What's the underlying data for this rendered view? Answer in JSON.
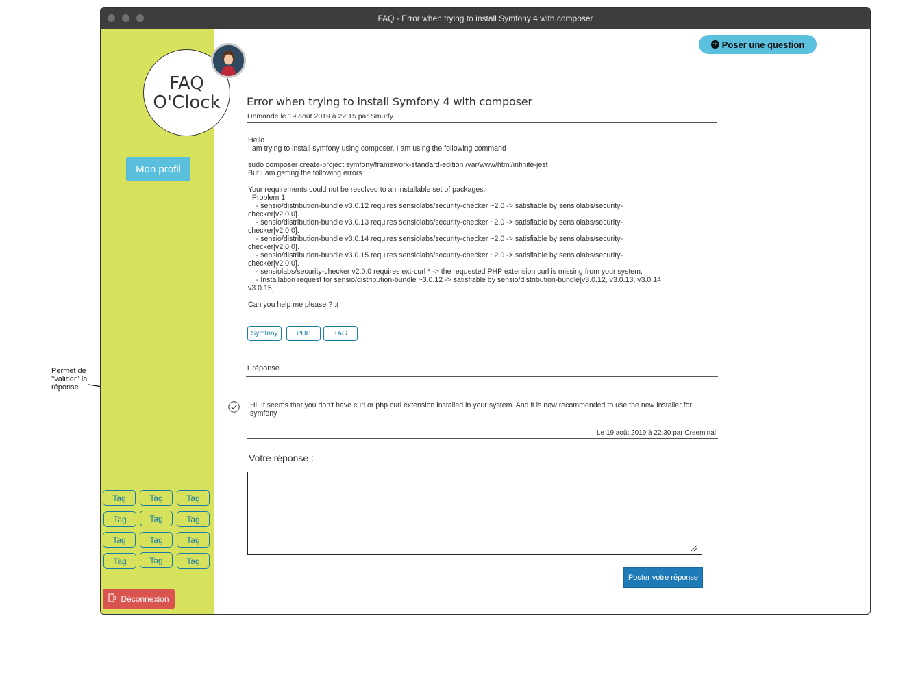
{
  "annotation": {
    "text": "Permet de ''valider'' la réponse"
  },
  "window": {
    "title": "FAQ - Error when trying to install Symfony 4 with composer"
  },
  "sidebar": {
    "logo_line1": "FAQ",
    "logo_line2": "O'Clock",
    "avatar_icon": "user-avatar-icon",
    "profile_label": "Mon profil",
    "tags": [
      "Tag",
      "Tag",
      "Tag",
      "Tag",
      "Tag",
      "Tag",
      "Tag",
      "Tag",
      "Tag",
      "Tag",
      "Tag",
      "Tag"
    ],
    "logout_label": "Déconnexion",
    "logout_icon": "sign-out-icon"
  },
  "header": {
    "ask_label": "Poser une question",
    "ask_icon": "plus-circle-icon"
  },
  "question": {
    "title": "Error when trying to install Symfony 4 with composer",
    "meta": "Demandé le 19 août 2019 à 22:15 par Smurfy",
    "body": "Hello\nI am trying to install symfony using composer. I am using the following command\n\nsudo composer create-project symfony/framework-standard-edition /var/www/html/infinite-jest\nBut I am getting the following errors\n\nYour requirements could not be resolved to an installable set of packages.\n  Problem 1\n    - sensio/distribution-bundle v3.0.12 requires sensiolabs/security-checker ~2.0 -> satisfiable by sensiolabs/security-\nchecker[v2.0.0].\n    - sensio/distribution-bundle v3.0.13 requires sensiolabs/security-checker ~2.0 -> satisfiable by sensiolabs/security-\nchecker[v2.0.0].\n    - sensio/distribution-bundle v3.0.14 requires sensiolabs/security-checker ~2.0 -> satisfiable by sensiolabs/security-\nchecker[v2.0.0].\n    - sensio/distribution-bundle v3.0.15 requires sensiolabs/security-checker ~2.0 -> satisfiable by sensiolabs/security-\nchecker[v2.0.0].\n    - sensiolabs/security-checker v2.0.0 requires ext-curl * -> the requested PHP extension curl is missing from your system.\n    - Installation request for sensio/distribution-bundle ~3.0.12 -> satisfiable by sensio/distribution-bundle[v3.0.12, v3.0.13, v3.0.14,\nv3.0.15].\n\nCan you help me please ? :(",
    "tags": [
      "Symfony",
      "PHP",
      "TAG"
    ]
  },
  "answers": {
    "count_label": "1 réponse",
    "items": [
      {
        "text": "Hi, It seems that you don't have curl or php curl extension installed in your system. And it is now recommended to use the new installer for symfony",
        "meta": "Le 19 août 2019 à 22:30 par Creeminal",
        "validate_icon": "check-circle-icon"
      }
    ]
  },
  "reply": {
    "label": "Votre réponse :",
    "value": "",
    "submit_label": "Poster votre réponse"
  }
}
